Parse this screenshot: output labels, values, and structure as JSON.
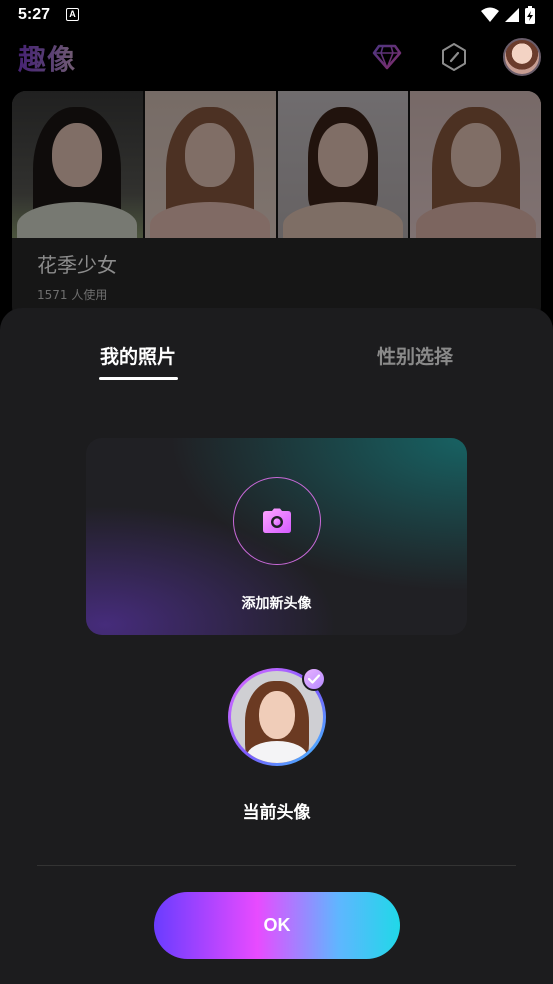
{
  "status_bar": {
    "time": "5:27",
    "notification_letter": "A"
  },
  "header": {
    "app_logo": "趣像",
    "icons": [
      "diamond-icon",
      "compass-icon",
      "profile-avatar"
    ]
  },
  "template_card": {
    "title": "花季少女",
    "usage_text": "1571 人使用",
    "photo_count": 4
  },
  "sheet": {
    "tabs": [
      {
        "label": "我的照片",
        "active": true
      },
      {
        "label": "性别选择",
        "active": false
      }
    ],
    "upload": {
      "label": "添加新头像",
      "icon": "camera-icon"
    },
    "current_avatar": {
      "label": "当前头像",
      "selected": true
    },
    "confirm_button": "OK"
  },
  "colors": {
    "background": "#000000",
    "sheet": "#1c1c1e",
    "accent_purple": "#e84bff",
    "accent_cyan": "#20d8e8",
    "accent_violet": "#6a3cff"
  }
}
